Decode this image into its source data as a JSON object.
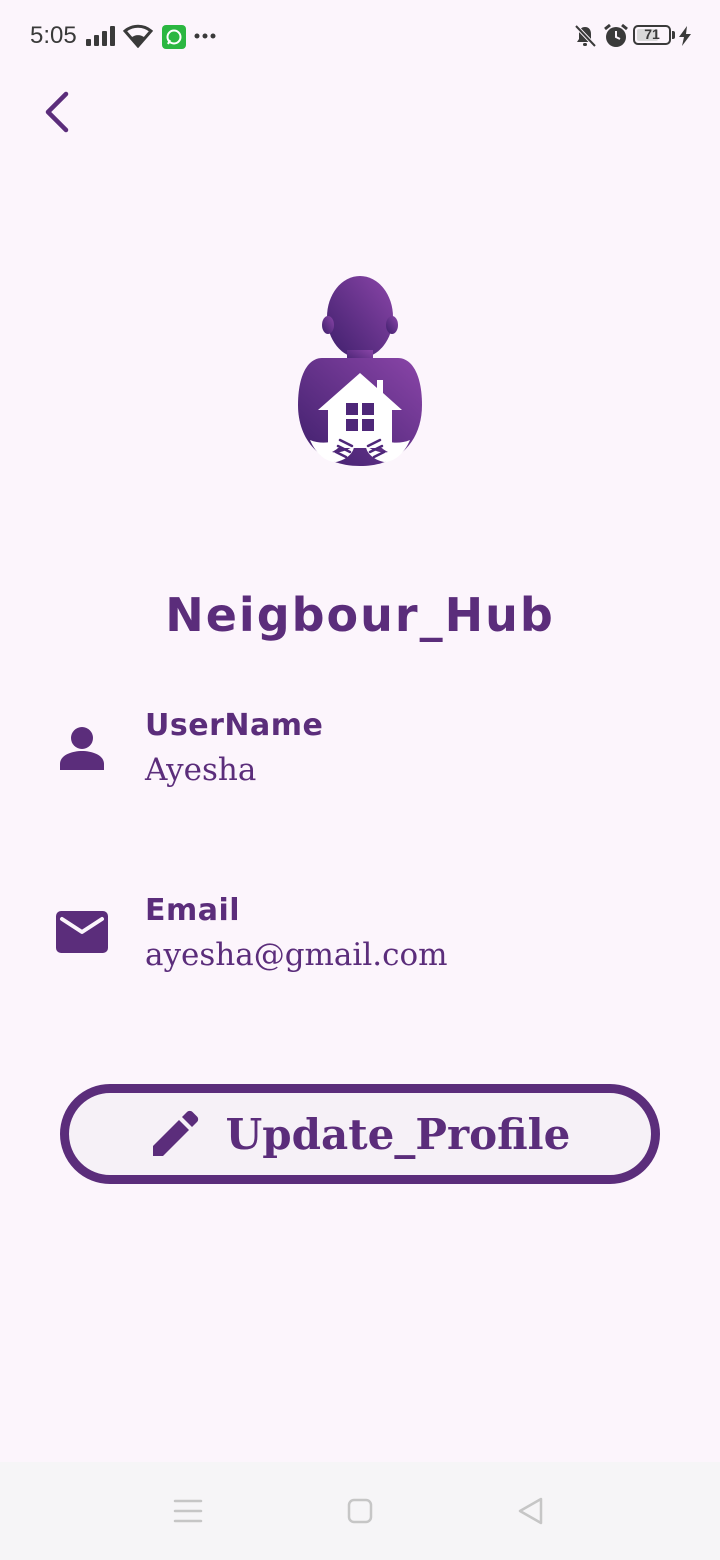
{
  "status_bar": {
    "time": "5:05",
    "battery": "71",
    "battery_level": 0.71,
    "icons": [
      "signal-icon",
      "wifi-icon",
      "whatsapp-icon",
      "more-icon",
      "mute-icon",
      "alarm-icon",
      "battery-icon",
      "charging-icon"
    ]
  },
  "header": {
    "back_icon": "chevron-left-icon"
  },
  "app": {
    "title": "Neigbour_Hub",
    "logo_icon": "neighbour-hub-logo"
  },
  "profile": {
    "username_label": "UserName",
    "username_value": "Ayesha",
    "email_label": "Email",
    "email_value": "ayesha@gmail.com"
  },
  "actions": {
    "update_label": "Update_Profile",
    "update_icon": "pencil-icon"
  },
  "nav_bar": {
    "items": [
      "menu-icon",
      "home-square-icon",
      "back-triangle-icon"
    ]
  },
  "colors": {
    "accent": "#5B2D7B",
    "background": "#FCF5FC",
    "button_fill": "#F6F1F7"
  }
}
